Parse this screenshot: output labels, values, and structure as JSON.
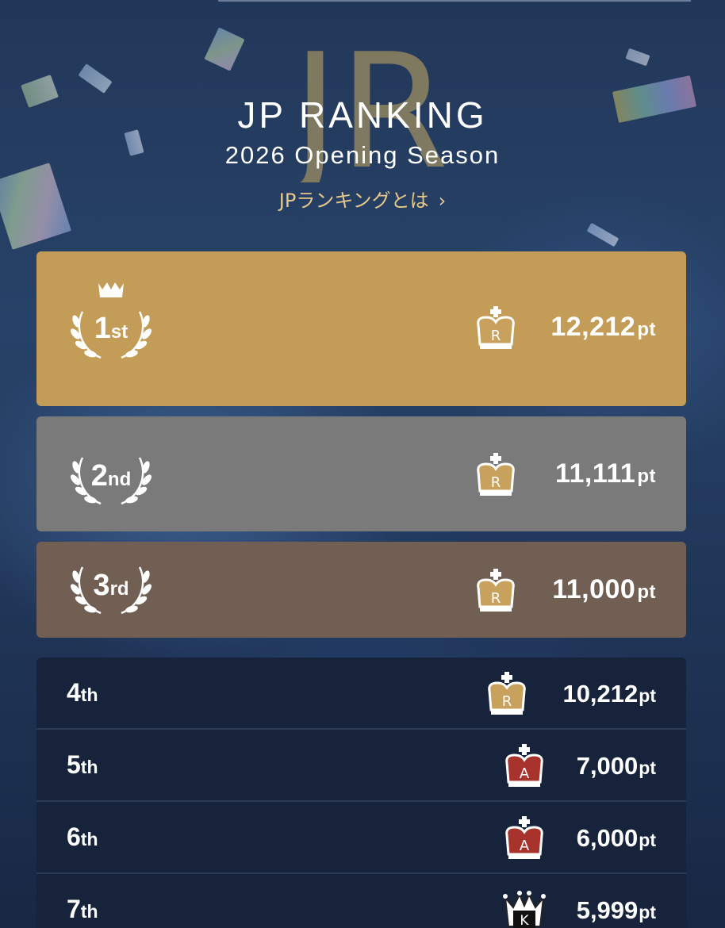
{
  "header": {
    "logo_text": "JR",
    "title": "JP RANKING",
    "subtitle": "2026 Opening Season",
    "about_link": "JPランキングとは",
    "about_chevron": "›"
  },
  "podium": [
    {
      "rank_num": "1",
      "rank_suffix": "st",
      "points": "12,212",
      "unit": "pt",
      "tier_letter": "R",
      "color": "#c39c57"
    },
    {
      "rank_num": "2",
      "rank_suffix": "nd",
      "points": "11,111",
      "unit": "pt",
      "tier_letter": "R",
      "color": "#7a7a7a"
    },
    {
      "rank_num": "3",
      "rank_suffix": "rd",
      "points": "11,000",
      "unit": "pt",
      "tier_letter": "R",
      "color": "#715f54"
    }
  ],
  "ranking": [
    {
      "rank_num": "4",
      "rank_suffix": "th",
      "points": "10,212",
      "unit": "pt",
      "tier_letter": "R",
      "tier": "gold"
    },
    {
      "rank_num": "5",
      "rank_suffix": "th",
      "points": "7,000",
      "unit": "pt",
      "tier_letter": "A",
      "tier": "red"
    },
    {
      "rank_num": "6",
      "rank_suffix": "th",
      "points": "6,000",
      "unit": "pt",
      "tier_letter": "A",
      "tier": "red"
    },
    {
      "rank_num": "7",
      "rank_suffix": "th",
      "points": "5,999",
      "unit": "pt",
      "tier_letter": "K",
      "tier": "white"
    }
  ],
  "colors": {
    "gold": "#c39c57",
    "silver": "#7a7a7a",
    "bronze": "#715f54",
    "list_bg": "#17233a",
    "link": "#e6c88a",
    "tier_red": "#a8322c"
  }
}
